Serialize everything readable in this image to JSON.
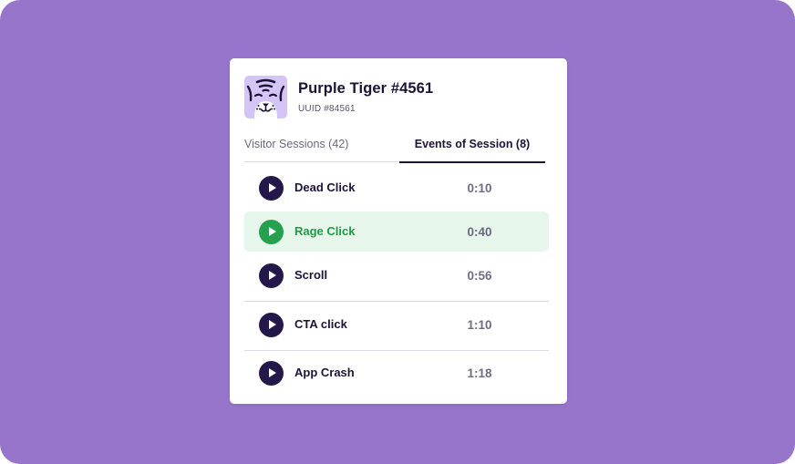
{
  "profile": {
    "name": "Purple Tiger #4561",
    "uuid": "UUID #84561",
    "avatar_icon": "tiger-face-icon"
  },
  "tabs": [
    {
      "label": "Visitor Sessions (42)",
      "selected": false
    },
    {
      "label": "Events of Session (8)",
      "selected": true
    }
  ],
  "events": [
    {
      "label": "Dead Click",
      "time": "0:10",
      "active": false
    },
    {
      "label": "Rage Click",
      "time": "0:40",
      "active": true
    },
    {
      "label": "Scroll",
      "time": "0:56",
      "active": false
    },
    {
      "label": "CTA click",
      "time": "1:10",
      "active": false
    },
    {
      "label": "App Crash",
      "time": "1:18",
      "active": false
    }
  ],
  "colors": {
    "background": "#9675cb",
    "card": "#ffffff",
    "primary_text": "#1c1437",
    "active_row_bg": "#e6f6ea",
    "active_accent": "#25a04e",
    "avatar_bg": "#d5c5f7"
  }
}
